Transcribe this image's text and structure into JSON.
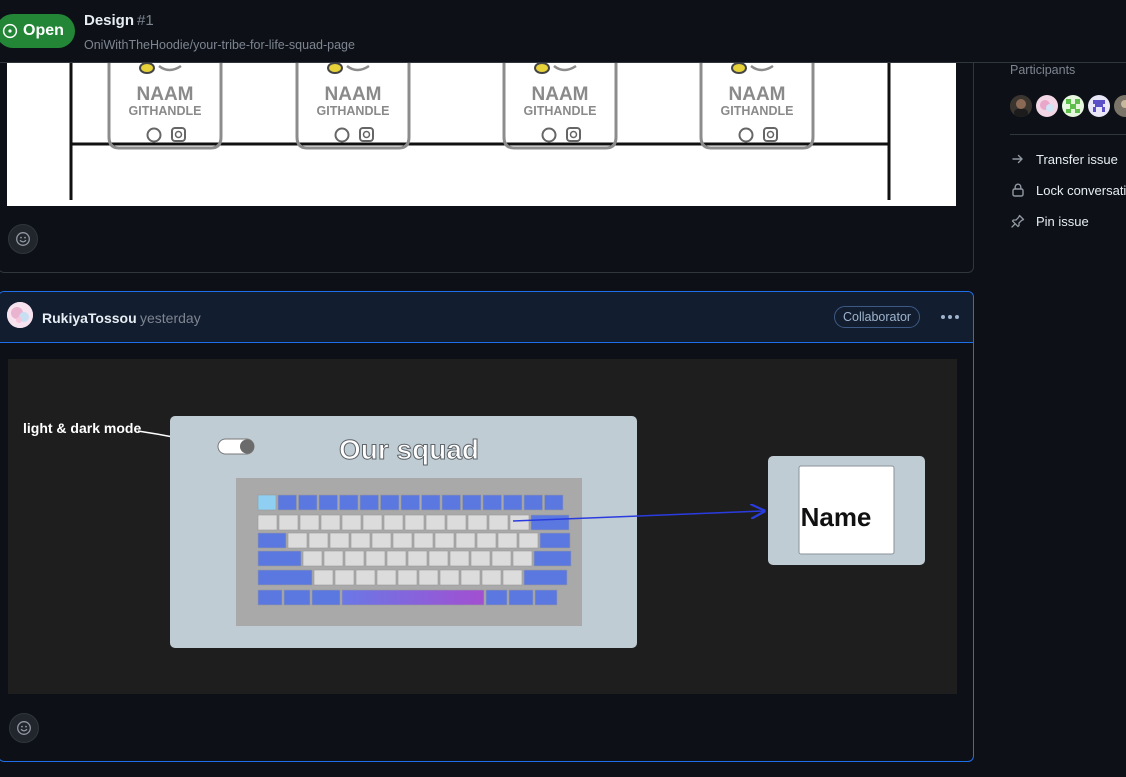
{
  "header": {
    "status_label": "Open",
    "title": "Design",
    "issue_number": "#1",
    "repo_path": "OniWithTheHoodie/your-tribe-for-life-squad-page"
  },
  "comment1": {
    "image": {
      "cards": [
        {
          "name": "NAAM",
          "handle": "GITHANDLE"
        },
        {
          "name": "NAAM",
          "handle": "GITHANDLE"
        },
        {
          "name": "NAAM",
          "handle": "GITHANDLE"
        },
        {
          "name": "NAAM",
          "handle": "GITHANDLE"
        }
      ]
    },
    "reaction_icon": "smiley-icon"
  },
  "comment2": {
    "author": "RukiyaTossou",
    "timestamp": "yesterday",
    "role_badge": "Collaborator",
    "image": {
      "annotation": "light & dark mode",
      "heading": "Our squad",
      "card_label": "Name"
    },
    "reaction_icon": "smiley-icon"
  },
  "sidebar": {
    "participants_label": "Participants",
    "actions": [
      {
        "label": "Transfer issue",
        "icon": "arrow-right-icon"
      },
      {
        "label": "Lock conversation",
        "icon": "lock-icon"
      },
      {
        "label": "Pin issue",
        "icon": "pin-icon"
      }
    ]
  },
  "colors": {
    "open_green": "#238636",
    "accent_blue": "#1f6feb",
    "bg": "#0d1117",
    "border": "#30363d"
  }
}
